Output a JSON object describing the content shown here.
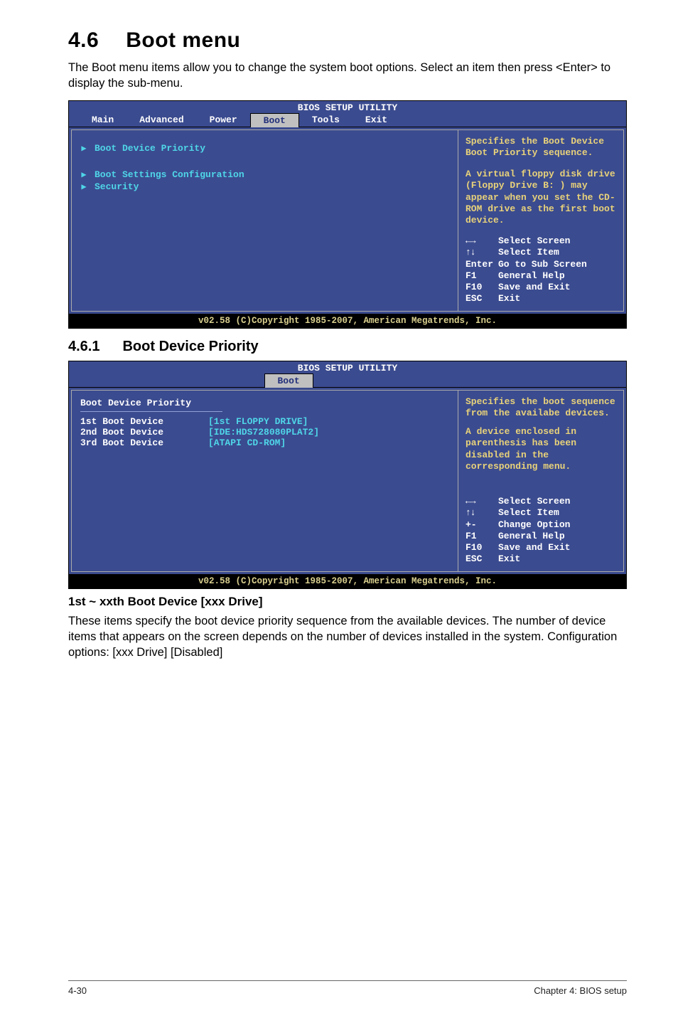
{
  "section": {
    "num": "4.6",
    "title": "Boot menu"
  },
  "intro": "The Boot menu items allow you to change the system boot options. Select an item then press <Enter> to display the sub-menu.",
  "bios_title": "BIOS SETUP UTILITY",
  "tabs": {
    "main": "Main",
    "advanced": "Advanced",
    "power": "Power",
    "boot": "Boot",
    "tools": "Tools",
    "exit": "Exit"
  },
  "bios1": {
    "menu": {
      "bdp": "Boot Device Priority",
      "bsc": "Boot Settings Configuration",
      "sec": "Security"
    },
    "help_top": "Specifies the Boot Device Boot Priority sequence.",
    "help_mid": "A virtual floppy disk drive (Floppy Drive B: ) may appear when you set the CD-ROM drive as the first boot device.",
    "keys": {
      "screen": "Select Screen",
      "item": "Select Item",
      "enter_k": "Enter",
      "enter": "Go to Sub Screen",
      "f1_k": "F1",
      "f1": "General Help",
      "f10_k": "F10",
      "f10": "Save and Exit",
      "esc_k": "ESC",
      "esc": "Exit"
    }
  },
  "footer_copy": "v02.58 (C)Copyright 1985-2007, American Megatrends, Inc.",
  "sub": {
    "num": "4.6.1",
    "title": "Boot Device Priority"
  },
  "bios2": {
    "heading": "Boot Device Priority",
    "rows": [
      {
        "label": "1st Boot Device",
        "value": "[1st FLOPPY DRIVE]"
      },
      {
        "label": "2nd Boot Device",
        "value": "[IDE:HDS728080PLAT2]"
      },
      {
        "label": "3rd Boot Device",
        "value": "[ATAPI CD-ROM]"
      }
    ],
    "help_top": "Specifies the boot sequence from the availabe devices.",
    "help_mid": "A device enclosed in parenthesis has been disabled in the corresponding menu.",
    "keys": {
      "screen": "Select Screen",
      "item": "Select Item",
      "pm_k": "+-",
      "pm": "Change Option",
      "f1_k": "F1",
      "f1": "General Help",
      "f10_k": "F10",
      "f10": "Save and Exit",
      "esc_k": "ESC",
      "esc": "Exit"
    }
  },
  "opt_heading": "1st ~ xxth Boot Device [xxx Drive]",
  "opt_body": "These items specify the boot device priority sequence from the available devices. The number of device items that appears on the screen depends on the number of devices installed in the system. Configuration options: [xxx Drive] [Disabled]",
  "page_footer": {
    "left": "4-30",
    "right": "Chapter 4: BIOS setup"
  }
}
